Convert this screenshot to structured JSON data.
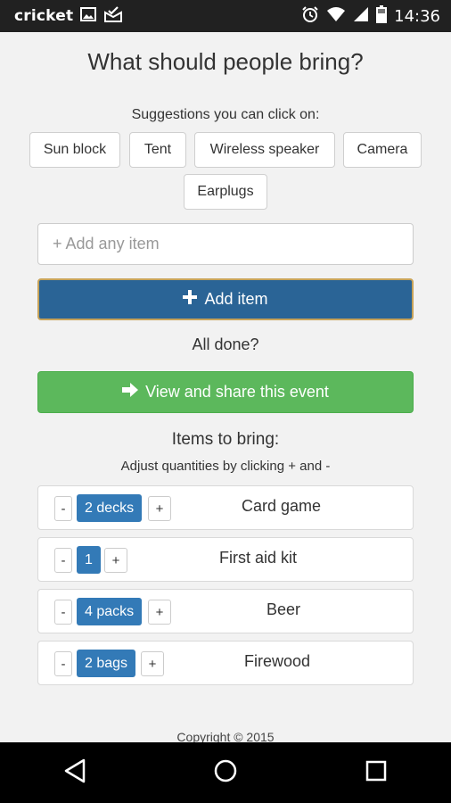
{
  "status_bar": {
    "carrier": "cricket",
    "time": "14:36",
    "icons": [
      "image-icon",
      "mail-check-icon",
      "alarm-icon",
      "wifi-icon",
      "signal-icon",
      "battery-icon"
    ]
  },
  "page": {
    "title": "What should people bring?",
    "suggestions_label": "Suggestions you can click on:",
    "suggestions": [
      "Sun block",
      "Tent",
      "Wireless speaker",
      "Camera",
      "Earplugs"
    ],
    "input_placeholder": "+ Add any item",
    "add_button_label": "Add item",
    "done_label": "All done?",
    "share_button_label": "View and share this event",
    "items_title": "Items to bring:",
    "items_subtitle": "Adjust quantities by clicking + and -",
    "items": [
      {
        "name": "Card game",
        "quantity": "2 decks"
      },
      {
        "name": "First aid kit",
        "quantity": "1"
      },
      {
        "name": "Beer",
        "quantity": "4 packs"
      },
      {
        "name": "Firewood",
        "quantity": "2 bags"
      }
    ],
    "minus_label": "-",
    "plus_label": "+",
    "copyright": "Copyright © 2015"
  },
  "colors": {
    "primary_button": "#2a6496",
    "success_button": "#5cb85c",
    "badge": "#337ab7",
    "status_bar": "#212121",
    "nav_bar": "#000000"
  },
  "nav_bar": {
    "icons": [
      "back-icon",
      "home-icon",
      "recents-icon"
    ]
  }
}
